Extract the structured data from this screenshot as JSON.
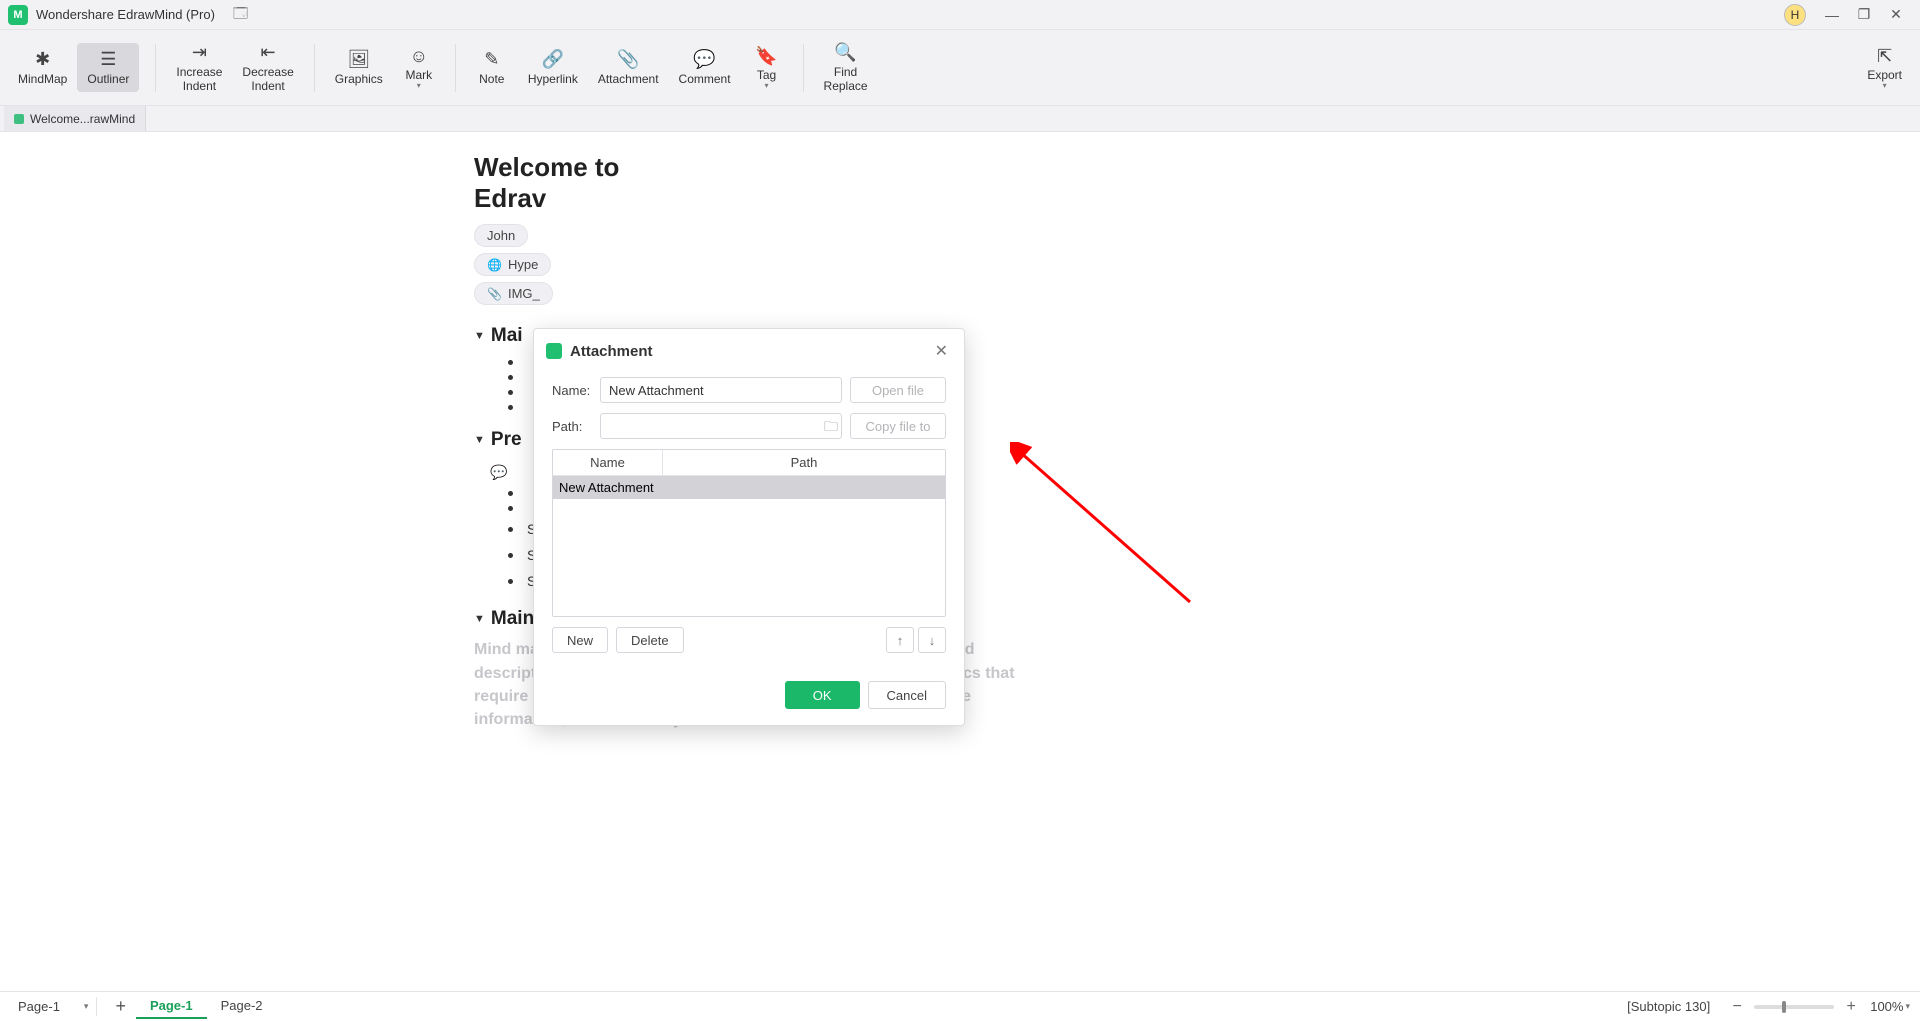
{
  "titlebar": {
    "app_name": "Wondershare EdrawMind (Pro)",
    "user_initial": "H"
  },
  "toolbar": {
    "mindmap": "MindMap",
    "outliner": "Outliner",
    "increase_indent": "Increase\nIndent",
    "decrease_indent": "Decrease\nIndent",
    "graphics": "Graphics",
    "mark": "Mark",
    "note": "Note",
    "hyperlink": "Hyperlink",
    "attachment": "Attachment",
    "comment": "Comment",
    "tag": "Tag",
    "find_replace": "Find\nReplace",
    "export": "Export"
  },
  "tabstrip": {
    "tab1": "Welcome...rawMind"
  },
  "outline": {
    "doc_title_line1": "Welcome to",
    "doc_title_line2": "Edrav",
    "chip_name": "John",
    "chip_hyper": "Hype",
    "chip_img": "IMG_",
    "main_topic1": "Mai",
    "pre_topic": "Pre",
    "subtopic_label": "Subtopic",
    "main_topic2": "Main Topic",
    "body": "Mind maps are known to be concise and to the point, and detailed descriptions generally do not appear in the subject text. For topics that require more detail, comments can be inserted to supplement the information, and these may"
  },
  "dialog": {
    "title": "Attachment",
    "name_label": "Name:",
    "name_value": "New Attachment",
    "open_file": "Open file",
    "path_label": "Path:",
    "path_value": "",
    "copy_file_to": "Copy file to",
    "col_name": "Name",
    "col_path": "Path",
    "row1_name": "New Attachment",
    "row1_path": "",
    "new": "New",
    "delete": "Delete",
    "ok": "OK",
    "cancel": "Cancel"
  },
  "statusbar": {
    "page_select": "Page-1",
    "page1": "Page-1",
    "page2": "Page-2",
    "subtopic": "[Subtopic 130]",
    "zoom": "100%"
  }
}
